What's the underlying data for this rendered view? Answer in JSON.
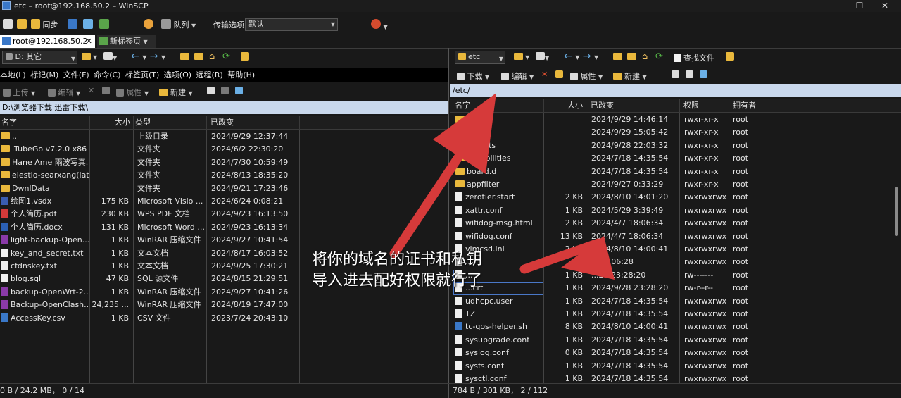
{
  "title": "etc – root@192.168.50.2 – WinSCP",
  "toolbar": {
    "sync": "同步",
    "queue": "队列",
    "transfer_label": "传输选项",
    "transfer_value": "默认"
  },
  "tabs": [
    {
      "label": "root@192.168.50.2"
    },
    {
      "label": "新标签页"
    }
  ],
  "left": {
    "drive": "D: 其它",
    "menu": [
      "本地(L)",
      "标记(M)",
      "文件(F)",
      "命令(C)",
      "标签页(T)",
      "选项(O)",
      "远程(R)",
      "帮助(H)"
    ],
    "actions": {
      "upload": "上传",
      "edit": "编辑",
      "props": "属性",
      "new": "新建"
    },
    "path": "D:\\浏览器下载 迅雷下载\\",
    "columns": [
      "名字",
      "大小",
      "类型",
      "已改变"
    ],
    "rows": [
      {
        "name": "..",
        "size": "",
        "type": "上级目录",
        "date": "2024/9/29 12:37:44",
        "icon": "up"
      },
      {
        "name": "iTubeGo v7.2.0 x86",
        "size": "",
        "type": "文件夹",
        "date": "2024/6/2 22:30:20",
        "icon": "folder"
      },
      {
        "name": "Hane Ame 雨波写真...",
        "size": "",
        "type": "文件夹",
        "date": "2024/7/30 10:59:49",
        "icon": "folder"
      },
      {
        "name": "elestio-searxang(lat...",
        "size": "",
        "type": "文件夹",
        "date": "2024/8/13 18:35:20",
        "icon": "folder"
      },
      {
        "name": "DwnlData",
        "size": "",
        "type": "文件夹",
        "date": "2024/9/21 17:23:46",
        "icon": "folder"
      },
      {
        "name": "绘图1.vsdx",
        "size": "175 KB",
        "type": "Microsoft Visio ...",
        "date": "2024/6/24 0:08:21",
        "icon": "visio"
      },
      {
        "name": "个人简历.pdf",
        "size": "230 KB",
        "type": "WPS PDF 文档",
        "date": "2024/9/23 16:13:50",
        "icon": "pdf"
      },
      {
        "name": "个人简历.docx",
        "size": "131 KB",
        "type": "Microsoft Word ...",
        "date": "2024/9/23 16:13:34",
        "icon": "word"
      },
      {
        "name": "light-backup-Open...",
        "size": "1 KB",
        "type": "WinRAR 压缩文件",
        "date": "2024/9/27 10:41:54",
        "icon": "rar"
      },
      {
        "name": "key_and_secret.txt",
        "size": "1 KB",
        "type": "文本文档",
        "date": "2024/8/17 16:03:52",
        "icon": "txt"
      },
      {
        "name": "cfdnskey.txt",
        "size": "1 KB",
        "type": "文本文档",
        "date": "2024/9/25 17:30:21",
        "icon": "txt"
      },
      {
        "name": "blog.sql",
        "size": "47 KB",
        "type": "SQL 源文件",
        "date": "2024/8/15 21:29:51",
        "icon": "txt"
      },
      {
        "name": "backup-OpenWrt-2...",
        "size": "1 KB",
        "type": "WinRAR 压缩文件",
        "date": "2024/9/27 10:41:26",
        "icon": "rar"
      },
      {
        "name": "Backup-OpenClash...",
        "size": "24,235 ...",
        "type": "WinRAR 压缩文件",
        "date": "2024/8/19 17:47:00",
        "icon": "rar"
      },
      {
        "name": "AccessKey.csv",
        "size": "1 KB",
        "type": "CSV 文件",
        "date": "2023/7/24 20:43:10",
        "icon": "csv"
      }
    ],
    "status": "0 B / 24.2 MB，  0 / 14"
  },
  "right": {
    "dir": "etc",
    "find": "查找文件",
    "actions": {
      "download": "下载",
      "edit": "编辑",
      "props": "属性",
      "new": "新建"
    },
    "path": "/etc/",
    "columns": [
      "名字",
      "大小",
      "已改变",
      "权限",
      "拥有者"
    ],
    "rows": [
      {
        "name": "..abs",
        "size": "",
        "date": "2024/9/29 14:46:14",
        "perm": "rwxr-xr-x",
        "owner": "root",
        "icon": "folder"
      },
      {
        "name": "",
        "size": "",
        "date": "2024/9/29 15:05:42",
        "perm": "rwxr-xr-x",
        "owner": "root",
        "icon": "folder"
      },
      {
        "name": "...cripts",
        "size": "",
        "date": "2024/9/28 22:03:32",
        "perm": "rwxr-xr-x",
        "owner": "root",
        "icon": "folder"
      },
      {
        "name": "capabilities",
        "size": "",
        "date": "2024/7/18 14:35:54",
        "perm": "rwxr-xr-x",
        "owner": "root",
        "icon": "folder"
      },
      {
        "name": "board.d",
        "size": "",
        "date": "2024/7/18 14:35:54",
        "perm": "rwxr-xr-x",
        "owner": "root",
        "icon": "folder"
      },
      {
        "name": "appfilter",
        "size": "",
        "date": "2024/9/27 0:33:29",
        "perm": "rwxr-xr-x",
        "owner": "root",
        "icon": "folder"
      },
      {
        "name": "zerotier.start",
        "size": "2 KB",
        "date": "2024/8/10 14:01:20",
        "perm": "rwxrwxrwx",
        "owner": "root",
        "icon": "file"
      },
      {
        "name": "xattr.conf",
        "size": "1 KB",
        "date": "2024/5/29 3:39:49",
        "perm": "rwxrwxrwx",
        "owner": "root",
        "icon": "file"
      },
      {
        "name": "wifidog-msg.html",
        "size": "2 KB",
        "date": "2024/4/7 18:06:34",
        "perm": "rwxrwxrwx",
        "owner": "root",
        "icon": "file"
      },
      {
        "name": "wifidog.conf",
        "size": "13 KB",
        "date": "2024/4/7 18:06:34",
        "perm": "rwxrwxrwx",
        "owner": "root",
        "icon": "file"
      },
      {
        "name": "vlmcsd.ini",
        "size": "2 KB",
        "date": "2024/8/10 14:00:41",
        "perm": "rwxrwxrwx",
        "owner": "root",
        "icon": "file"
      },
      {
        "name": "...",
        "size": "",
        "date": "...13:06:28",
        "perm": "rwxrwxrwx",
        "owner": "root",
        "icon": "file"
      },
      {
        "name": "...",
        "size": "1 KB",
        "date": "...28 23:28:20",
        "perm": "rw-------",
        "owner": "root",
        "icon": "file"
      },
      {
        "name": "...crt",
        "size": "1 KB",
        "date": "2024/9/28 23:28:20",
        "perm": "rw-r--r--",
        "owner": "root",
        "icon": "file"
      },
      {
        "name": "udhcpc.user",
        "size": "1 KB",
        "date": "2024/7/18 14:35:54",
        "perm": "rwxrwxrwx",
        "owner": "root",
        "icon": "file"
      },
      {
        "name": "TZ",
        "size": "1 KB",
        "date": "2024/7/18 14:35:54",
        "perm": "rwxrwxrwx",
        "owner": "root",
        "icon": "file"
      },
      {
        "name": "tc-qos-helper.sh",
        "size": "8 KB",
        "date": "2024/8/10 14:00:41",
        "perm": "rwxrwxrwx",
        "owner": "root",
        "icon": "script"
      },
      {
        "name": "sysupgrade.conf",
        "size": "1 KB",
        "date": "2024/7/18 14:35:54",
        "perm": "rwxrwxrwx",
        "owner": "root",
        "icon": "file"
      },
      {
        "name": "syslog.conf",
        "size": "0 KB",
        "date": "2024/7/18 14:35:54",
        "perm": "rwxrwxrwx",
        "owner": "root",
        "icon": "file"
      },
      {
        "name": "sysfs.conf",
        "size": "1 KB",
        "date": "2024/7/18 14:35:54",
        "perm": "rwxrwxrwx",
        "owner": "root",
        "icon": "file"
      },
      {
        "name": "sysctl.conf",
        "size": "1 KB",
        "date": "2024/7/18 14:35:54",
        "perm": "rwxrwxrwx",
        "owner": "root",
        "icon": "file"
      }
    ],
    "status": "784 B / 301 KB，  2 / 112"
  },
  "annotation": {
    "line1": "将你的域名的证书和私钥",
    "line2": "导入进去配好权限就行了"
  },
  "colors": {
    "arrow": "#d63a3a",
    "folder": "#e9b83c",
    "accent": "#3a78c8"
  }
}
